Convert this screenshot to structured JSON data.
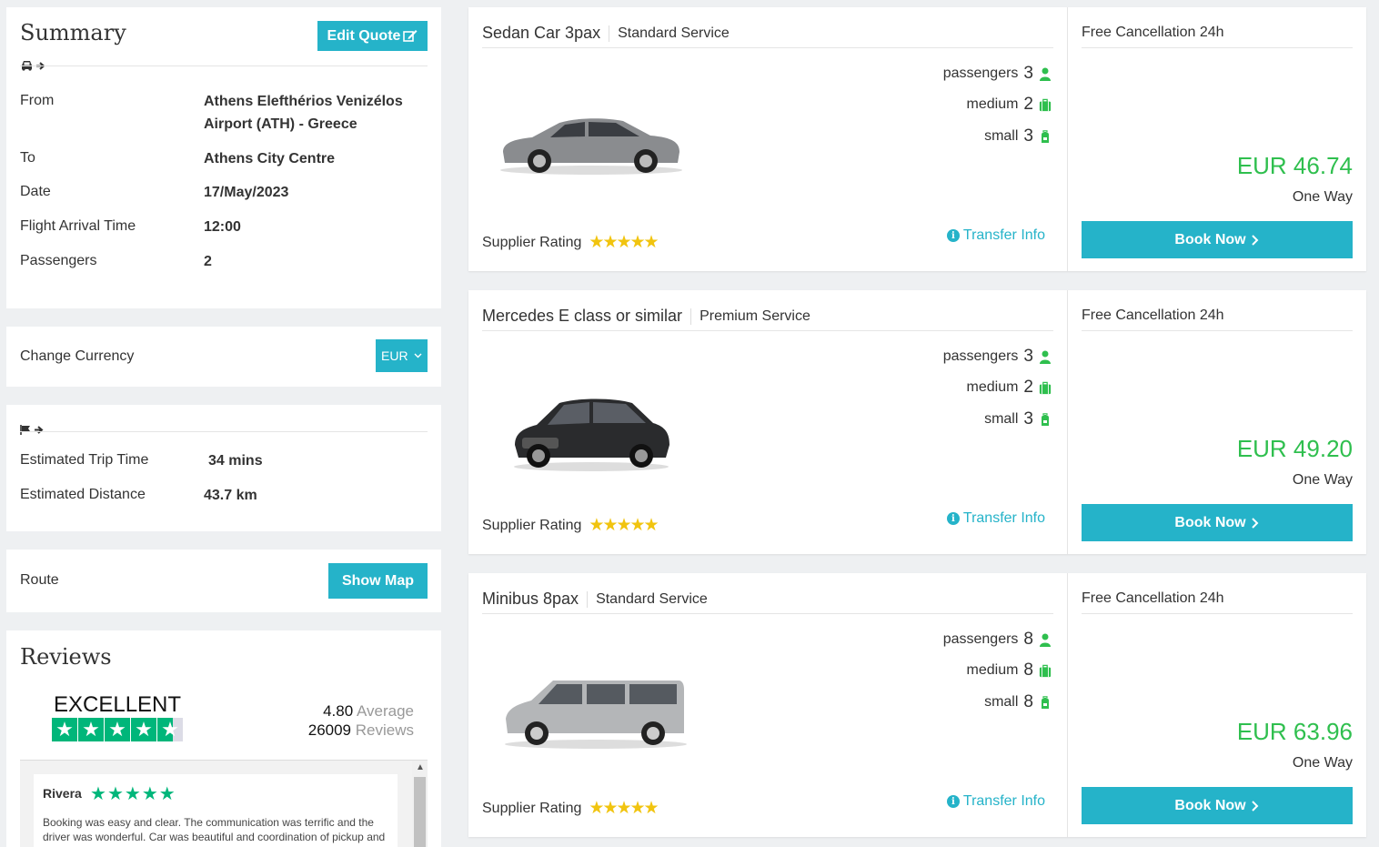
{
  "summary": {
    "title": "Summary",
    "edit_quote_label": "Edit Quote",
    "rows": [
      {
        "label": "From",
        "value": "Athens Elefthérios Venizélos Airport (ATH) - Greece"
      },
      {
        "label": "To",
        "value": "Athens City Centre"
      },
      {
        "label": "Date",
        "value": "17/May/2023"
      },
      {
        "label": "Flight Arrival Time",
        "value": "12:00"
      },
      {
        "label": "Passengers",
        "value": "2"
      }
    ]
  },
  "currency": {
    "label": "Change Currency",
    "selected": "EUR"
  },
  "trip": {
    "rows": [
      {
        "label": "Estimated Trip Time",
        "value": "34 mins"
      },
      {
        "label": "Estimated Distance",
        "value": "43.7 km"
      }
    ]
  },
  "route": {
    "label": "Route",
    "button": "Show Map"
  },
  "reviews": {
    "title": "Reviews",
    "rating_word": "EXCELLENT",
    "average_value": "4.80",
    "average_label": "Average",
    "count_value": "26009",
    "count_label": "Reviews",
    "rating_stars": 4.6,
    "items": [
      {
        "name": "Rivera",
        "stars": 5,
        "text": "Booking was easy and clear. The communication was terrific and the driver was wonderful. Car was beautiful and coordination of pickup and drop-off was smooth."
      }
    ]
  },
  "vehicles": [
    {
      "name": "Sedan Car 3pax",
      "service": "Standard Service",
      "passengers_label": "passengers",
      "passengers": "3",
      "medium_label": "medium",
      "medium": "2",
      "small_label": "small",
      "small": "3",
      "supplier_label": "Supplier Rating",
      "supplier_stars": 4.5,
      "transfer_info": "Transfer Info",
      "cancellation": "Free Cancellation 24h",
      "price": "EUR 46.74",
      "trip_type": "One Way",
      "book": "Book Now",
      "car_color": "#8a8c8f"
    },
    {
      "name": "Mercedes E class or similar",
      "service": "Premium Service",
      "passengers_label": "passengers",
      "passengers": "3",
      "medium_label": "medium",
      "medium": "2",
      "small_label": "small",
      "small": "3",
      "supplier_label": "Supplier Rating",
      "supplier_stars": 4.5,
      "transfer_info": "Transfer Info",
      "cancellation": "Free Cancellation 24h",
      "price": "EUR 49.20",
      "trip_type": "One Way",
      "book": "Book Now",
      "car_color": "#2a2b2d"
    },
    {
      "name": "Minibus 8pax",
      "service": "Standard Service",
      "passengers_label": "passengers",
      "passengers": "8",
      "medium_label": "medium",
      "medium": "8",
      "small_label": "small",
      "small": "8",
      "supplier_label": "Supplier Rating",
      "supplier_stars": 4.5,
      "transfer_info": "Transfer Info",
      "cancellation": "Free Cancellation 24h",
      "price": "EUR 63.96",
      "trip_type": "One Way",
      "book": "Book Now",
      "car_color": "#b4b6b8"
    }
  ],
  "colors": {
    "accent": "#25b3c9",
    "price_green": "#2fbf4e",
    "trustpilot_green": "#00b67a",
    "star_yellow": "#f1c40f"
  }
}
